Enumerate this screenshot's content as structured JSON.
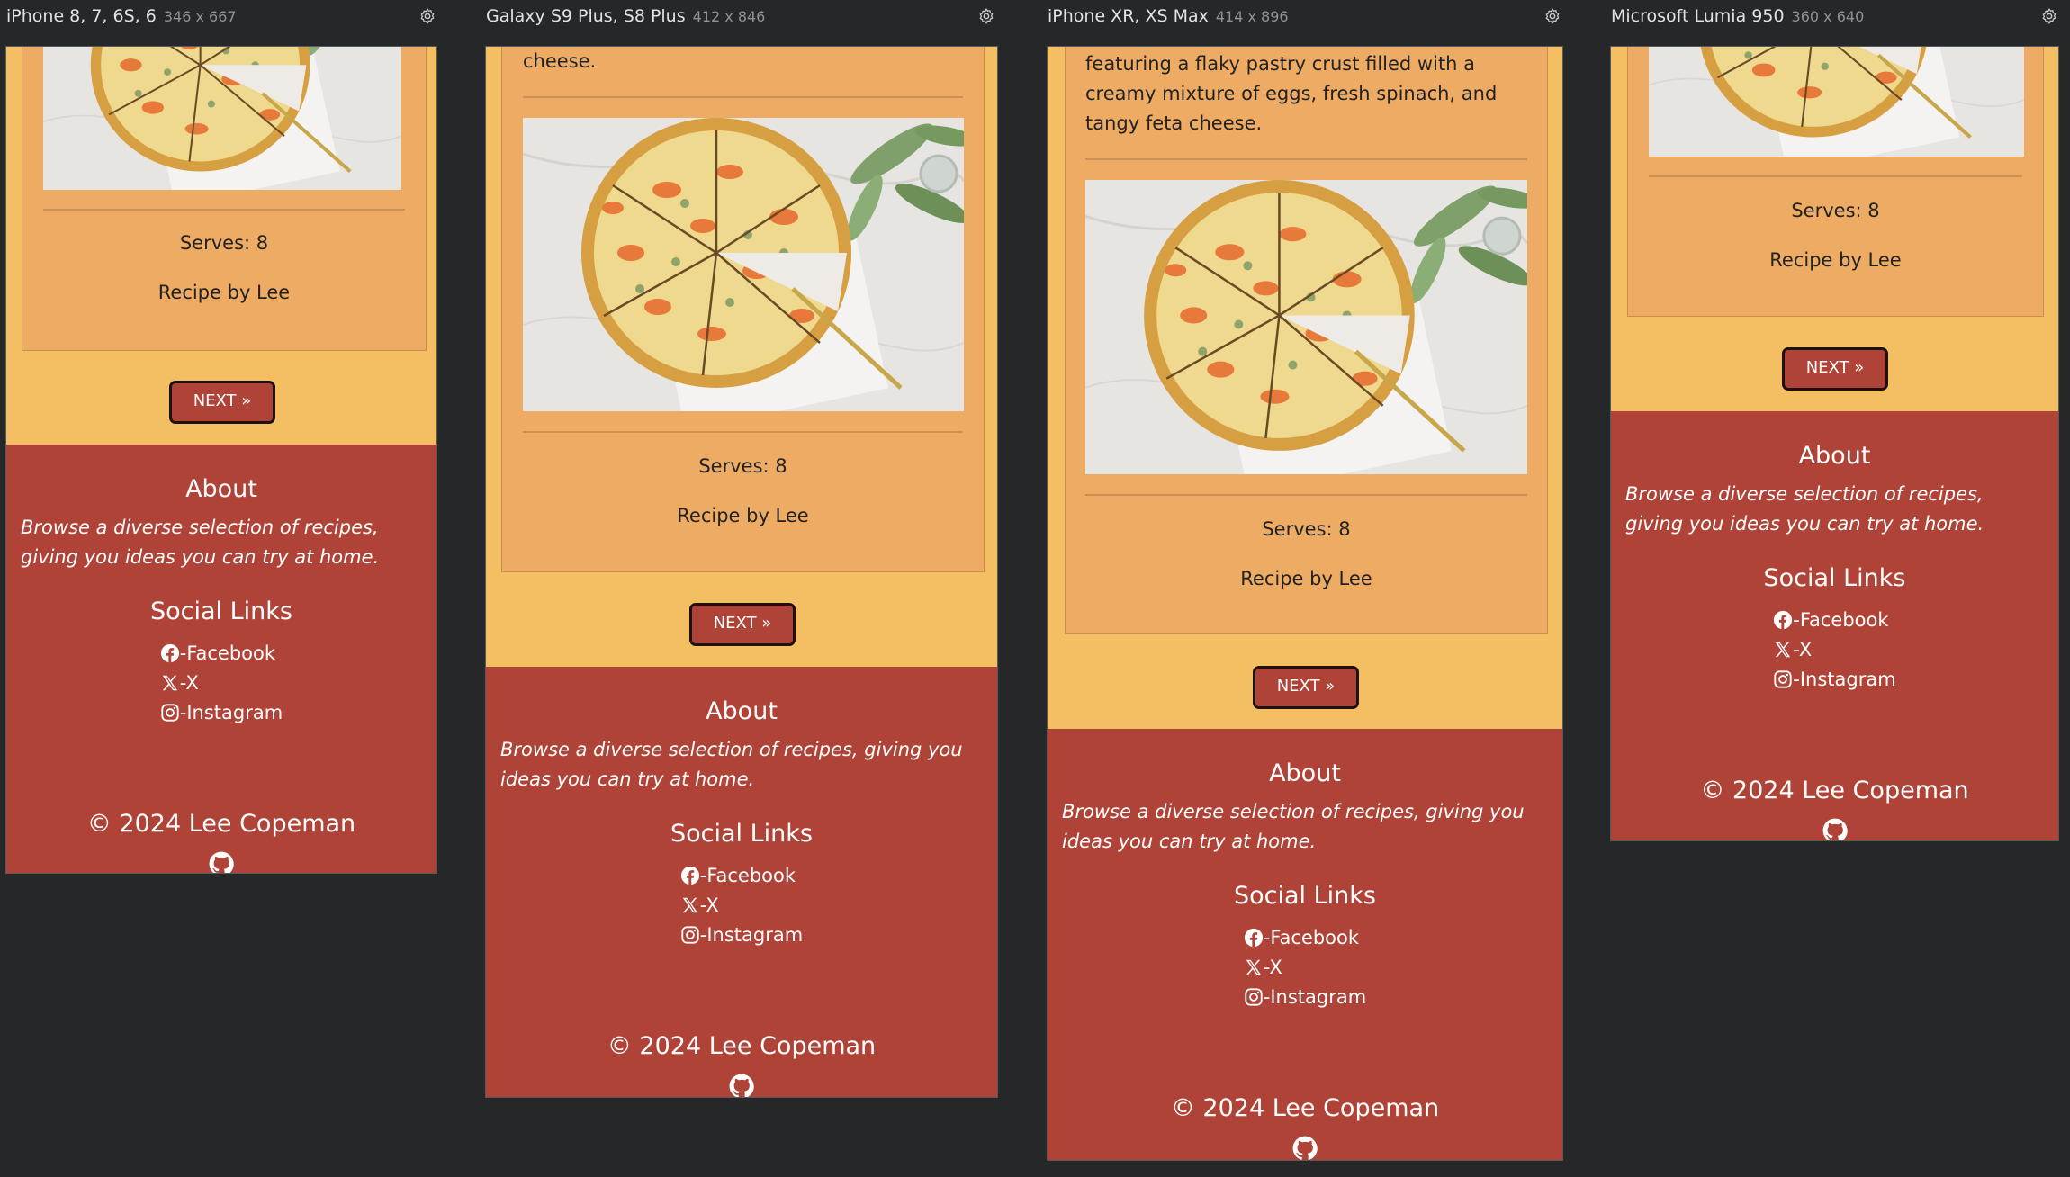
{
  "devices": [
    {
      "name": "iPhone 8, 7, 6S, 6",
      "size": "346 x 667"
    },
    {
      "name": "Galaxy S9 Plus, S8 Plus",
      "size": "412 x 846"
    },
    {
      "name": "iPhone XR, XS Max",
      "size": "414 x 896"
    },
    {
      "name": "Microsoft Lumia 950",
      "size": "360 x 640"
    }
  ],
  "recipe": {
    "description_tail_galaxy": "cheese.",
    "description_tail_xr": "featuring a flaky pastry crust filled with a creamy mixture of eggs, fresh spinach, and tangy feta cheese.",
    "serves": "Serves: 8",
    "author": "Recipe by Lee"
  },
  "pagination": {
    "next_label": "NEXT »"
  },
  "footer": {
    "about_heading": "About",
    "about_text": "Browse a diverse selection of recipes, giving you ideas you can try at home.",
    "social_heading": "Social Links",
    "social_links": [
      {
        "label": "-Facebook",
        "icon": "facebook-icon"
      },
      {
        "label": "-X",
        "icon": "x-icon"
      },
      {
        "label": "-Instagram",
        "icon": "instagram-icon"
      }
    ],
    "copyright": "© 2024 Lee Copeman",
    "github_icon": "github-icon"
  },
  "colors": {
    "page_background": "#f4bf62",
    "card": "#eeab63",
    "footer": "#b04337",
    "button": "#b04337",
    "toolbar_background": "#262729"
  }
}
